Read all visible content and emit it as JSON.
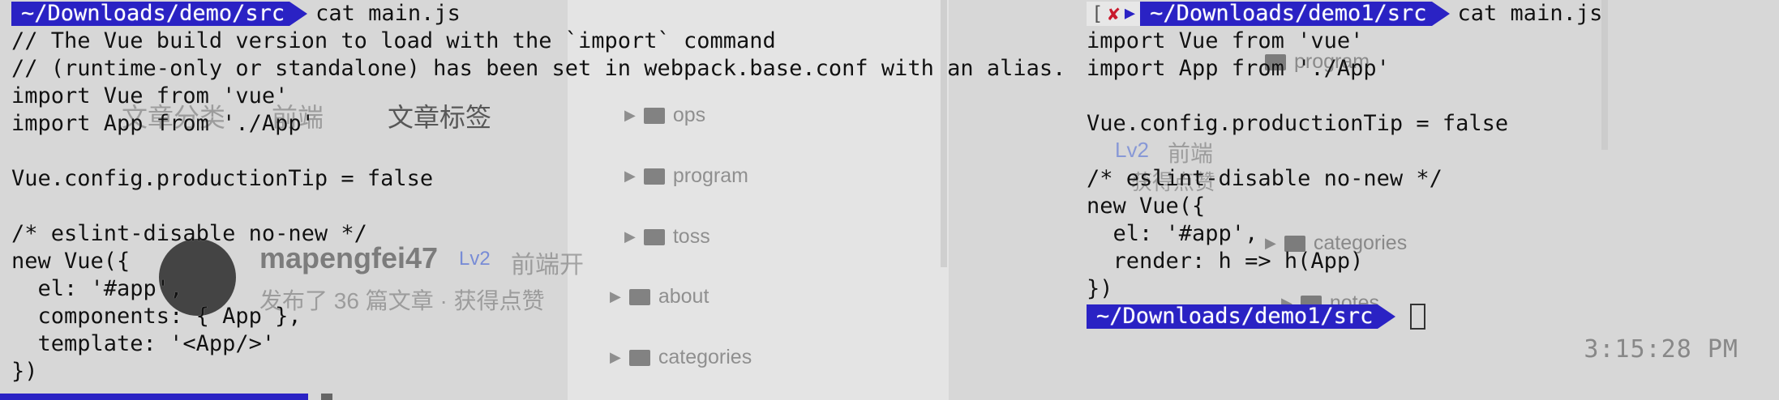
{
  "left_terminal": {
    "prompt_path": "~/Downloads/demo/src",
    "command": "cat main.js",
    "lines": [
      "// The Vue build version to load with the `import` command",
      "// (runtime-only or standalone) has been set in webpack.base.conf with an alias.",
      "import Vue from 'vue'",
      "import App from './App'",
      "",
      "Vue.config.productionTip = false",
      "",
      "/* eslint-disable no-new */",
      "new Vue({",
      "  el: '#app',",
      "  components: { App },",
      "  template: '<App/>'",
      "})"
    ]
  },
  "right_terminal": {
    "status_bracket": "[",
    "status_fail": "✘",
    "prompt_path": "~/Downloads/demo1/src",
    "command": "cat main.js",
    "lines": [
      "import Vue from 'vue'",
      "import App from './App'",
      "",
      "Vue.config.productionTip = false",
      "",
      "/* eslint-disable no-new */",
      "new Vue({",
      "  el: '#app',",
      "  render: h => h(App)",
      "})"
    ],
    "final_prompt_path": "~/Downloads/demo1/src"
  },
  "clock": "3:15:28 PM",
  "background_window": {
    "folders": [
      "ops",
      "program",
      "toss",
      "about",
      "categories"
    ],
    "right_folders": [
      "program",
      "categories",
      "notes"
    ],
    "tabs": [
      "文章分类",
      "前端",
      "文章标签"
    ],
    "author": "mapengfei47",
    "level": "Lv2",
    "role": "前端开",
    "stats": "发布了 36 篇文章 · 获得点赞",
    "right_role": "前端",
    "right_stats": "获得点赞"
  },
  "colors": {
    "prompt_bg": "#2a22c4",
    "fail_mark": "#c8192c"
  }
}
